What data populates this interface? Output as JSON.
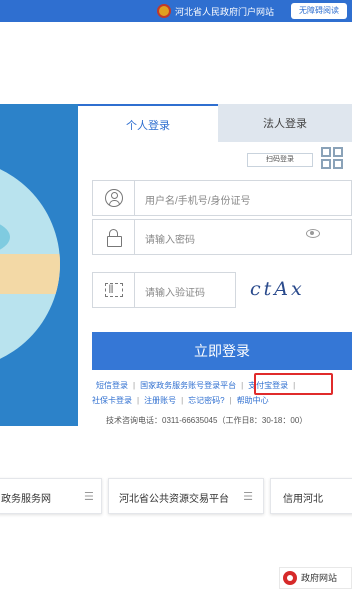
{
  "header": {
    "site_title": "河北省人民政府门户网站",
    "accessible_btn": "无障碍阅读"
  },
  "login": {
    "tabs": [
      "个人登录",
      "法人登录"
    ],
    "qr_login": "扫码登录",
    "username_placeholder": "用户名/手机号/身份证号",
    "password_placeholder": "请输入密码",
    "captcha_placeholder": "请输入验证码",
    "captcha_text": "ctAx",
    "submit": "立即登录",
    "links_row1": [
      "短信登录",
      "国家政务服务账号登录平台",
      "支付宝登录"
    ],
    "links_row2": [
      "社保卡登录",
      "注册账号",
      "忘记密码?",
      "帮助中心"
    ],
    "tech_support": "技术咨询电话：0311-66635045（工作日8：30-18：00）"
  },
  "services": [
    "政务服务网",
    "河北省公共资源交易平台",
    "信用河北"
  ],
  "corner_badge": "政府网站",
  "colors": {
    "primary": "#3577d6",
    "highlight": "#e02b2b",
    "hero": "#2c82c9"
  }
}
